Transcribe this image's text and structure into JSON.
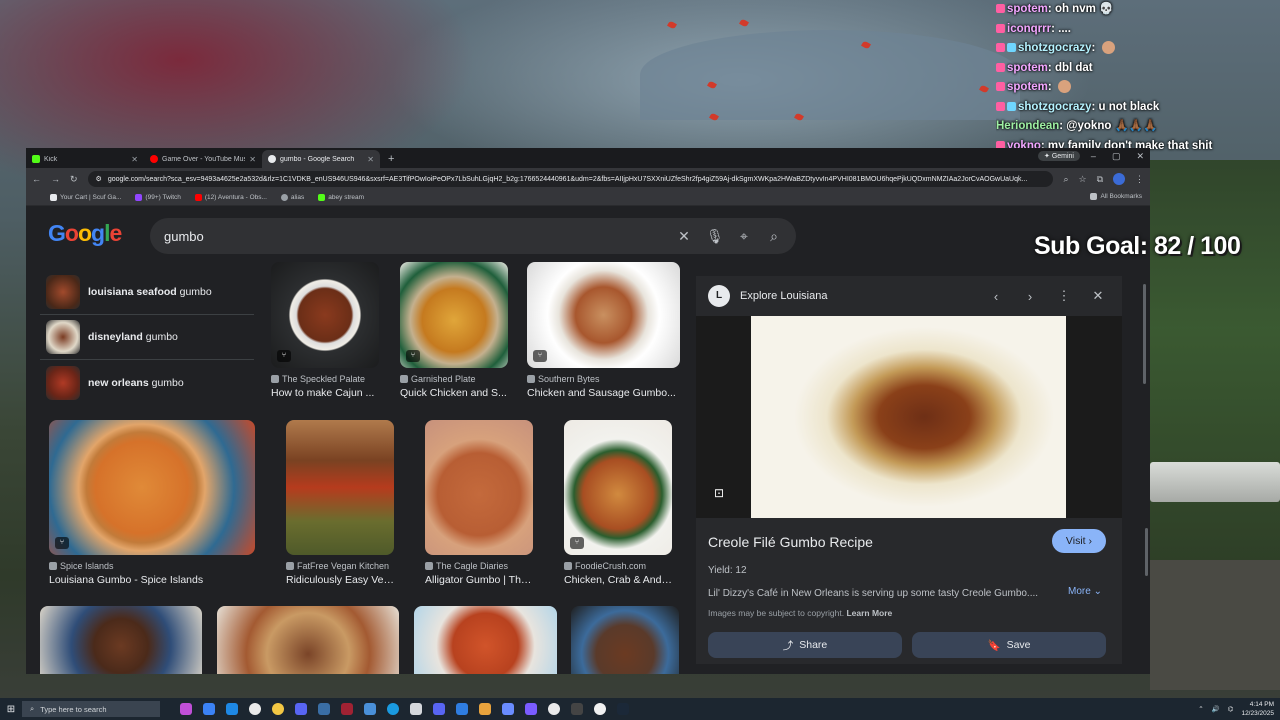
{
  "chat": [
    {
      "user": "spotem",
      "msg": "oh nvm 💀",
      "cls": ""
    },
    {
      "user": "iconqrrr",
      "msg": "....",
      "cls": ""
    },
    {
      "user": "shotzgocrazy",
      "msg": "",
      "cls": "u3"
    },
    {
      "user": "spotem",
      "msg": "dbl dat",
      "cls": ""
    },
    {
      "user": "spotem",
      "msg": "",
      "cls": ""
    },
    {
      "user": "shotzgocrazy",
      "msg": "u not black",
      "cls": "u3"
    },
    {
      "user": "Heriondean",
      "msg": "@yokno 🙏🏾🙏🏾🙏🏾",
      "cls": "u2"
    },
    {
      "user": "yokno",
      "msg": "my family don't make that shit",
      "cls": ""
    }
  ],
  "sub_goal": "Sub Goal:  82 / 100",
  "tabs": [
    {
      "label": "Kick",
      "color": "#53fc18"
    },
    {
      "label": "Game Over - YouTube Music",
      "color": "#ff0000"
    },
    {
      "label": "gumbo - Google Search",
      "color": "#e8eaed"
    }
  ],
  "gemini_label": "Gemini",
  "url": "google.com/search?sca_esv=9493a4625e2a532d&rlz=1C1VDKB_enUS946US946&sxsrf=AE3TifPOwIoiPeOPx7LbSuhLGjqH2_b2g:1766524440961&udm=2&fbs=AIIjpHxU7SXXniUZfeShr2fp4giZ59Aj-dkSgmXWKpa2HWaBZDtyvvIn4PVHI081BMOU6hqePjkUQDxmNMZIAa2JorCvAOGwUaUqk...",
  "bookmarks": [
    "Your Cart | Scuf Ga...",
    "(99+) Twitch",
    "(12) Aventura - Obs...",
    "alias",
    "abey stream"
  ],
  "all_bookmarks": "All Bookmarks",
  "google_logo": "Google",
  "search_query": "gumbo",
  "related": [
    {
      "bold": "louisiana seafood",
      "rest": " gumbo"
    },
    {
      "bold": "disneyland",
      "rest": " gumbo"
    },
    {
      "bold": "new orleans",
      "rest": " gumbo"
    }
  ],
  "results": [
    {
      "source": "The Speckled Palate",
      "title": "How to make Cajun ..."
    },
    {
      "source": "Garnished Plate",
      "title": "Quick Chicken and S..."
    },
    {
      "source": "Southern Bytes",
      "title": "Chicken and Sausage Gumbo..."
    },
    {
      "source": "Spice Islands",
      "title": "Louisiana Gumbo - Spice Islands"
    },
    {
      "source": "FatFree Vegan Kitchen",
      "title": "Ridiculously Easy Vege..."
    },
    {
      "source": "The Cagle Diaries",
      "title": "Alligator Gumbo | The ..."
    },
    {
      "source": "FoodieCrush.com",
      "title": "Chicken, Crab & Andou..."
    }
  ],
  "panel": {
    "site": "Explore Louisiana",
    "title": "Creole Filé Gumbo Recipe",
    "visit": "Visit",
    "yield": "Yield: 12",
    "desc": "Lil' Dizzy's Café in New Orleans is serving up some tasty Creole Gumbo....",
    "more": "More",
    "copyright": "Images may be subject to copyright.",
    "learn_more": "Learn More",
    "share": "Share",
    "save": "Save"
  },
  "taskbar": {
    "search_placeholder": "Type here to search",
    "time": "4:14 PM",
    "date": "12/23/2025"
  }
}
